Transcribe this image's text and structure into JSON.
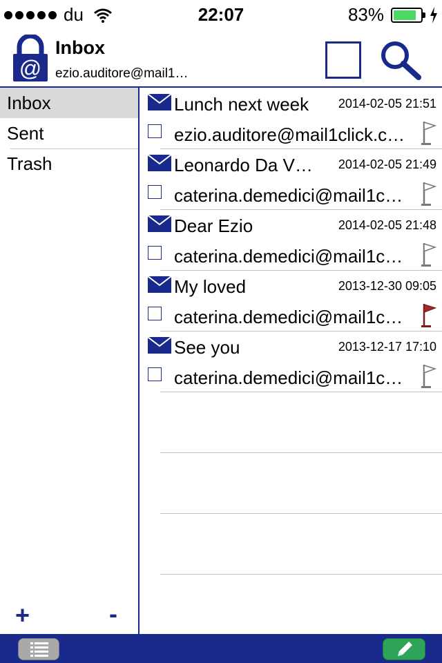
{
  "status": {
    "carrier": "du",
    "time": "22:07",
    "battery_text": "83%",
    "battery_level": 0.83,
    "battery_color": "#4cd964"
  },
  "header": {
    "title": "Inbox",
    "account": "ezio.auditore@mail1…",
    "app_icon": "lock-at-icon",
    "accent": "#1a2a8c"
  },
  "sidebar": {
    "folders": [
      {
        "label": "Inbox",
        "active": true
      },
      {
        "label": "Sent",
        "active": false
      },
      {
        "label": "Trash",
        "active": false
      }
    ],
    "add_label": "+",
    "remove_label": "-"
  },
  "messages": [
    {
      "subject": "Lunch next week",
      "date": "2014-02-05 21:51",
      "sender": "ezio.auditore@mail1click.c…",
      "flagged": false
    },
    {
      "subject": "Leonardo Da V…",
      "date": "2014-02-05 21:49",
      "sender": "caterina.demedici@mail1c…",
      "flagged": false
    },
    {
      "subject": "Dear Ezio",
      "date": "2014-02-05 21:48",
      "sender": "caterina.demedici@mail1c…",
      "flagged": false
    },
    {
      "subject": "My loved",
      "date": "2013-12-30 09:05",
      "sender": "caterina.demedici@mail1c…",
      "flagged": true
    },
    {
      "subject": "See you",
      "date": "2013-12-17 17:10",
      "sender": "caterina.demedici@mail1c…",
      "flagged": false
    }
  ],
  "bottom": {
    "list_icon": "list-icon",
    "compose_icon": "pencil-icon",
    "compose_color": "#2fa35a"
  }
}
